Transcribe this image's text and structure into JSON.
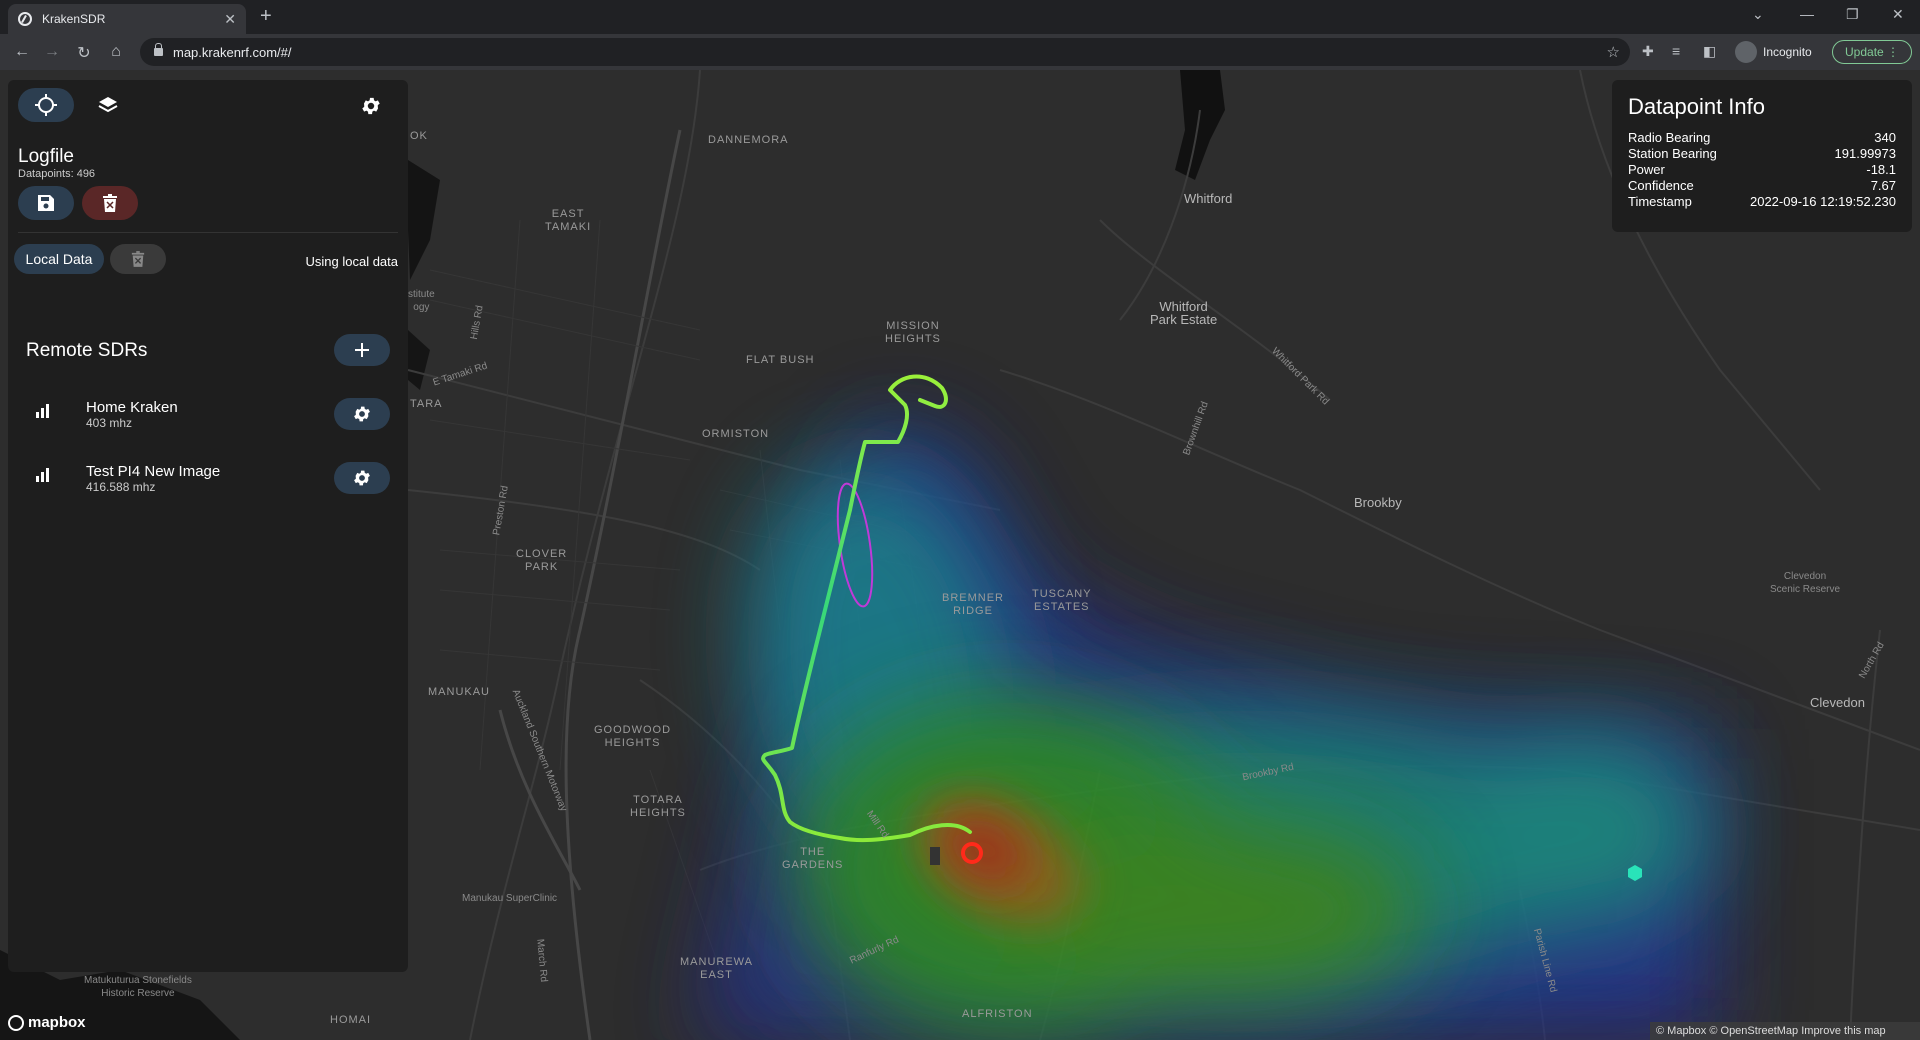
{
  "browser": {
    "tab_title": "KrakenSDR",
    "url": "map.krakenrf.com/#/",
    "profile_label": "Incognito",
    "update_label": "Update"
  },
  "panel": {
    "logfile_title": "Logfile",
    "datapoints_label": "Datapoints: 496",
    "local_data_label": "Local Data",
    "local_status": "Using local data",
    "remote_title": "Remote SDRs",
    "sdrs": [
      {
        "name": "Home Kraken",
        "freq": "403 mhz"
      },
      {
        "name": "Test PI4 New Image",
        "freq": "416.588 mhz"
      }
    ]
  },
  "info": {
    "title": "Datapoint Info",
    "rows": [
      {
        "label": "Radio Bearing",
        "value": "340"
      },
      {
        "label": "Station Bearing",
        "value": "191.99973"
      },
      {
        "label": "Power",
        "value": "-18.1"
      },
      {
        "label": "Confidence",
        "value": "7.67"
      },
      {
        "label": "Timestamp",
        "value": "2022-09-16 12:19:52.230"
      }
    ]
  },
  "map": {
    "labels": {
      "dannemora": "DANNEMORA",
      "east_tamaki": "EAST\nTAMAKI",
      "whitford": "Whitford",
      "whitford_park": "Whitford\nPark Estate",
      "mission_heights": "MISSION\nHEIGHTS",
      "flat_bush": "FLAT BUSH",
      "ormiston": "ORMISTON",
      "brookby": "Brookby",
      "clover_park": "CLOVER\nPARK",
      "bremner_ridge": "BREMNER\nRIDGE",
      "tuscany_estates": "TUSCANY\nESTATES",
      "clevedon_reserve": "Clevedon\nScenic Reserve",
      "clevedon": "Clevedon",
      "manukau": "MANUKAU",
      "goodwood_heights": "GOODWOOD\nHEIGHTS",
      "totara_heights": "TOTARA\nHEIGHTS",
      "the_gardens": "THE\nGARDENS",
      "manukau_superclinic": "Manukau SuperClinic",
      "manurewa_east": "MANUREWA\nEAST",
      "alfriston": "ALFRISTON",
      "homai": "HOMAI",
      "matukuturua": "Matukuturua Stonefields\nHistoric Reserve",
      "tara": "TARA",
      "ok": "OK",
      "stitute": "stitute\nogy",
      "brookby_rd": "Brookby Rd",
      "whitford_park_rd": "Whitford Park Rd",
      "brownhill_rd": "Brownhill Rd",
      "mill_rd": "Mill Rd",
      "ranfurly_rd": "Ranfurly Rd",
      "preston_rd": "Preston Rd",
      "hills_rd": "Hills Rd",
      "e_tamaki_rd": "E Tamaki Rd",
      "motorway": "Auckland Southern Motorway",
      "march_rd": "March Rd",
      "parish_line_rd": "Parish Line Rd",
      "north_rd": "North Rd"
    },
    "mapbox_label": "mapbox",
    "attribution": "© Mapbox © OpenStreetMap  Improve this map"
  }
}
